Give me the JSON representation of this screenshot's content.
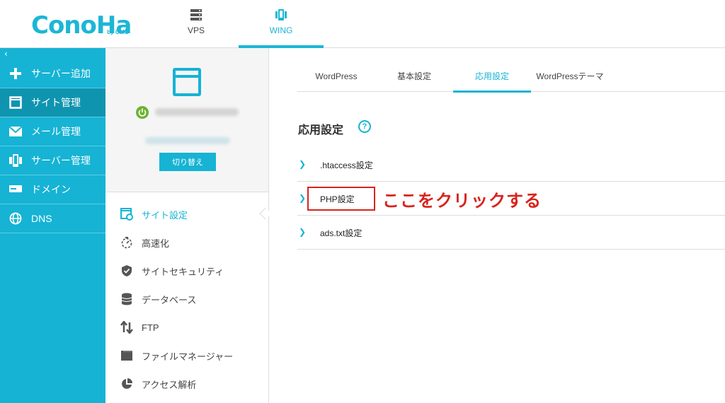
{
  "header": {
    "logo_text": "ConoHa",
    "logo_sub": "by GMO",
    "tabs": [
      {
        "label": "VPS",
        "icon": "server-icon"
      },
      {
        "label": "WING",
        "icon": "mobile-wing-icon"
      }
    ]
  },
  "sidebar": {
    "collapse_icon": "‹",
    "items": [
      {
        "label": "サーバー追加",
        "icon": "plus-icon"
      },
      {
        "label": "サイト管理",
        "icon": "window-icon"
      },
      {
        "label": "メール管理",
        "icon": "mail-icon"
      },
      {
        "label": "サーバー管理",
        "icon": "server-manage-icon"
      },
      {
        "label": "ドメイン",
        "icon": "domain-icon"
      },
      {
        "label": "DNS",
        "icon": "globe-icon"
      }
    ],
    "active_index": 1
  },
  "site_panel": {
    "switch_label": "切り替え",
    "nav": [
      {
        "label": "サイト設定",
        "icon": "site-settings-icon"
      },
      {
        "label": "高速化",
        "icon": "stopwatch-icon"
      },
      {
        "label": "サイトセキュリティ",
        "icon": "shield-icon"
      },
      {
        "label": "データベース",
        "icon": "database-icon"
      },
      {
        "label": "FTP",
        "icon": "transfer-arrows-icon"
      },
      {
        "label": "ファイルマネージャー",
        "icon": "folder-icon"
      },
      {
        "label": "アクセス解析",
        "icon": "pie-chart-icon"
      }
    ]
  },
  "main": {
    "tabs": [
      "WordPress",
      "基本設定",
      "応用設定",
      "WordPressテーマ"
    ],
    "active_tab": 2,
    "section_title": "応用設定",
    "help_symbol": "?",
    "accordion": [
      {
        "label": ".htaccess設定"
      },
      {
        "label": "PHP設定"
      },
      {
        "label": "ads.txt設定"
      }
    ],
    "annotation": "ここをクリックする"
  },
  "colors": {
    "accent": "#16b3d4",
    "sidebar_active": "#0f94b0",
    "annotation_red": "#d8231d",
    "power_green": "#6ab42d"
  }
}
